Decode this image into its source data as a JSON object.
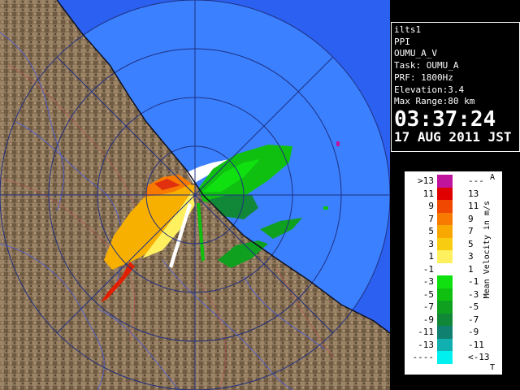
{
  "info": {
    "site": "ilts1",
    "mode": "PPI",
    "product": "OUMU_A_V",
    "task": "Task: OUMU_A",
    "prf": "PRF: 1800Hz",
    "elevation": "Elevation:3.4",
    "max_range": "Max Range:80 km",
    "time": "03:37:24",
    "date": "17 AUG 2011 JST"
  },
  "legend": {
    "title": "Mean Velocity in m/s",
    "corner_top": "A",
    "corner_bottom": "T",
    "rows": [
      {
        "left": ">13",
        "right": "---",
        "color": "#c0149c"
      },
      {
        "left": "11",
        "right": "13",
        "color": "#e00000"
      },
      {
        "left": "9",
        "right": "11",
        "color": "#f04800"
      },
      {
        "left": "7",
        "right": "9",
        "color": "#f87a00"
      },
      {
        "left": "5",
        "right": "7",
        "color": "#f8a800"
      },
      {
        "left": "3",
        "right": "5",
        "color": "#f8cc10"
      },
      {
        "left": "1",
        "right": "3",
        "color": "#fff060"
      },
      {
        "left": "-1",
        "right": "1",
        "color": "#ffffff"
      },
      {
        "left": "-3",
        "right": "-1",
        "color": "#10e010"
      },
      {
        "left": "-5",
        "right": "-3",
        "color": "#10c010"
      },
      {
        "left": "-7",
        "right": "-5",
        "color": "#10a020"
      },
      {
        "left": "-9",
        "right": "-7",
        "color": "#108838"
      },
      {
        "left": "-11",
        "right": "-9",
        "color": "#108070"
      },
      {
        "left": "-13",
        "right": "-11",
        "color": "#10b0b0"
      },
      {
        "left": "----",
        "right": "<-13",
        "color": "#00f0f0"
      }
    ]
  }
}
